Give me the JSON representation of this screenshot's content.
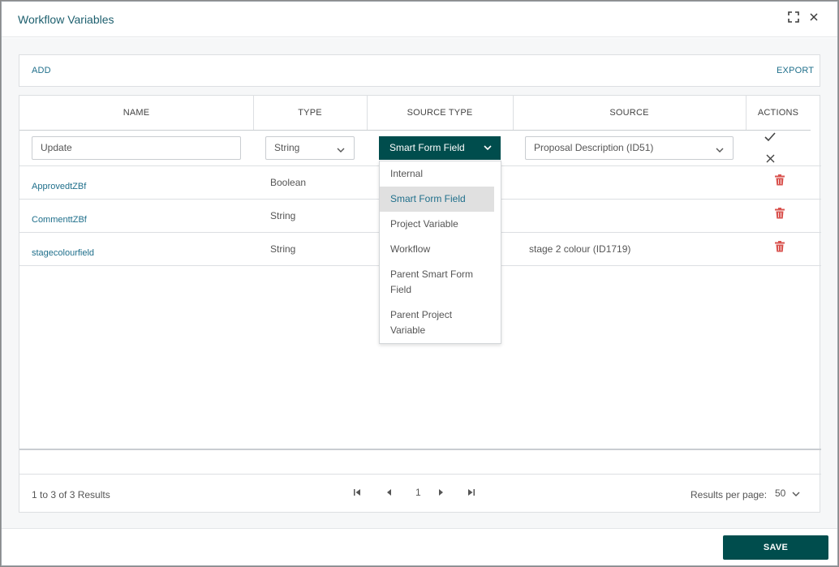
{
  "dialog": {
    "title": "Workflow Variables",
    "fullscreen_icon": "fullscreen-icon",
    "close_icon": "close-icon"
  },
  "toolbar": {
    "add_label": "ADD",
    "export_label": "EXPORT"
  },
  "grid": {
    "columns": [
      "NAME",
      "TYPE",
      "SOURCE TYPE",
      "SOURCE",
      "ACTIONS"
    ],
    "edit_row": {
      "name_value": "Update",
      "type_value": "String",
      "source_type_value": "Smart Form Field",
      "source_value": "Proposal Description (ID51)"
    },
    "rows": [
      {
        "name": "ApprovedtZBf",
        "type": "Boolean",
        "source": ""
      },
      {
        "name": "CommenttZBf",
        "type": "String",
        "source": ""
      },
      {
        "name": "stagecolourfield",
        "type": "String",
        "source": "stage 2 colour (ID1719)"
      }
    ]
  },
  "dropdown": {
    "options": [
      "Internal",
      "Smart Form Field",
      "Project Variable",
      "Workflow",
      "Parent Smart Form Field",
      "Parent Project Variable"
    ],
    "option_lines": [
      [
        "Internal"
      ],
      [
        "Smart Form Field"
      ],
      [
        "Project Variable"
      ],
      [
        "Workflow"
      ],
      [
        "Parent Smart Form",
        "Field"
      ],
      [
        "Parent Project",
        "Variable"
      ]
    ],
    "selected": "Smart Form Field"
  },
  "footer": {
    "results_text": "1 to 3 of 3 Results",
    "page_number": "1",
    "per_page_label": "Results per page:",
    "per_page_value": "50"
  },
  "actions": {
    "save_label": "SAVE"
  },
  "colors": {
    "primary": "#004d4d",
    "link": "#1f6f8b",
    "delete": "#d9534f"
  }
}
